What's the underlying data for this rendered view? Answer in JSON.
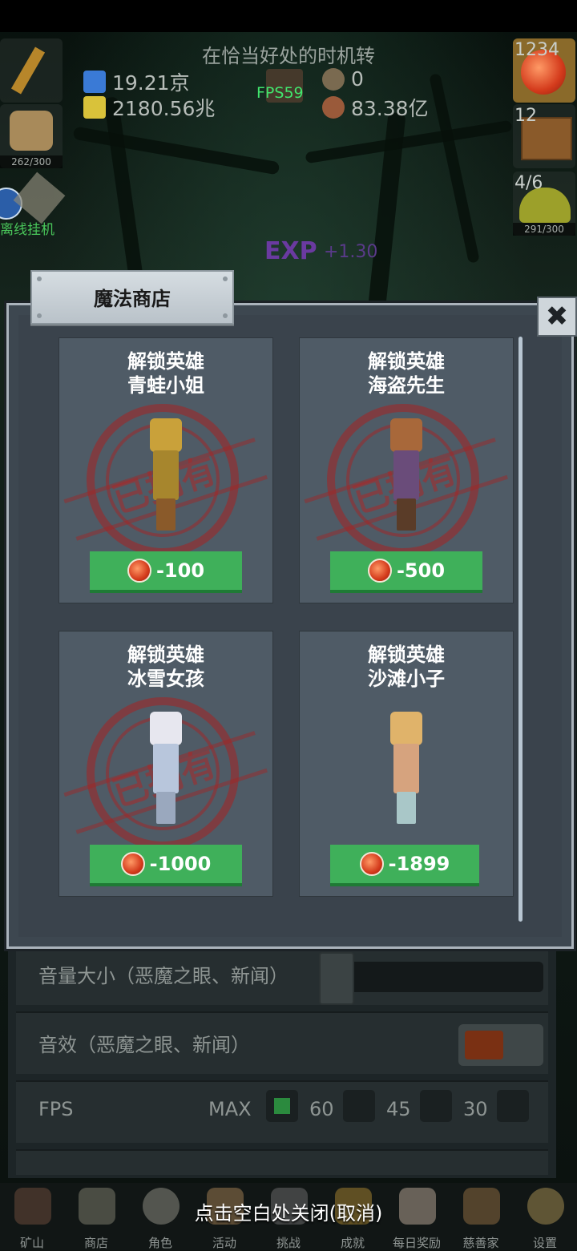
{
  "hud": {
    "title": "在恰当好处的时机转",
    "gems_blue": "19.21京",
    "gems_yellow": "2180.56兆",
    "fps": "FPS59",
    "seeds": "0",
    "meat": "83.38亿",
    "potion_count": "1234",
    "chest_count": "12",
    "slime_count": "4/6",
    "food_progress": "262/300",
    "slime_progress": "291/300",
    "offline_label": "离线挂机",
    "exp_label": "EXP",
    "exp_gain": "+1.30"
  },
  "modal": {
    "title": "魔法商店",
    "cards": [
      {
        "title_line1": "解锁英雄",
        "title_line2": "青蛙小姐",
        "price": "-100",
        "owned": true,
        "stamp_text": "已拥有",
        "hero_colors": [
          "#c9a13a",
          "#a7862d",
          "#8a5a2a"
        ]
      },
      {
        "title_line1": "解锁英雄",
        "title_line2": "海盗先生",
        "price": "-500",
        "owned": true,
        "stamp_text": "已拥有",
        "hero_colors": [
          "#a8683a",
          "#6a4c7a",
          "#5a3c28"
        ]
      },
      {
        "title_line1": "解锁英雄",
        "title_line2": "冰雪女孩",
        "price": "-1000",
        "owned": true,
        "stamp_text": "已拥有",
        "hero_colors": [
          "#e7e7ef",
          "#b8c6dc",
          "#9aa8be"
        ]
      },
      {
        "title_line1": "解锁英雄",
        "title_line2": "沙滩小子",
        "price": "-1899",
        "owned": false,
        "stamp_text": "",
        "hero_colors": [
          "#e0b36a",
          "#d6a37e",
          "#a9c7c8"
        ]
      }
    ]
  },
  "settings": {
    "volume_label": "音量大小（恶魔之眼、新闻）",
    "sfx_label": "音效（恶魔之眼、新闻）",
    "fps_label": "FPS",
    "fps_options": [
      "MAX",
      "60",
      "45",
      "30"
    ],
    "fps_selected": "MAX"
  },
  "close_hint": "点击空白处关闭(取消)",
  "nav": [
    "矿山",
    "商店",
    "角色",
    "活动",
    "挑战",
    "成就",
    "每日奖励",
    "慈善家",
    "设置"
  ]
}
